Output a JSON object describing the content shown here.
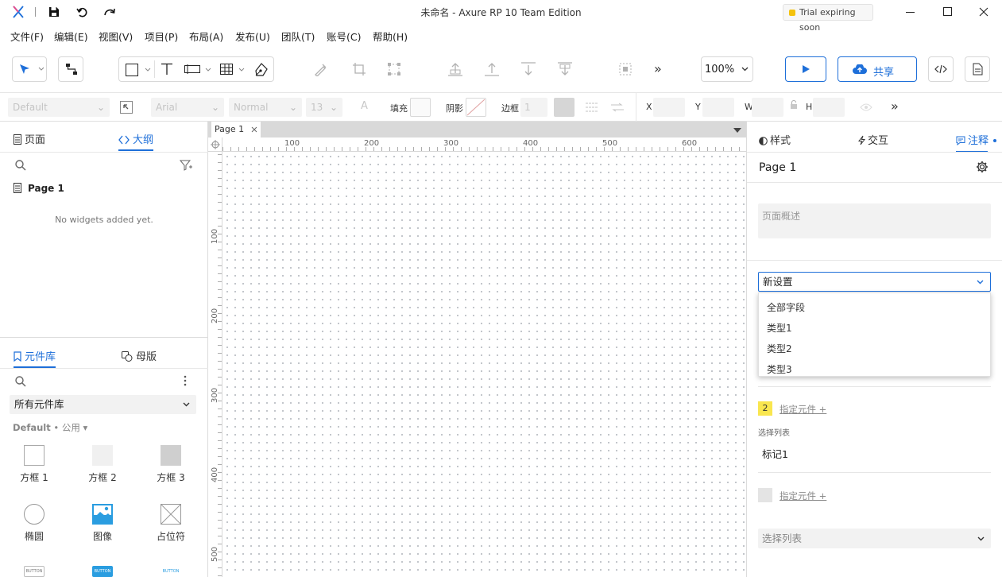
{
  "app": {
    "title": "未命名 - Axure RP 10 Team Edition",
    "trial_badge": "Trial expiring soon"
  },
  "menu": [
    "文件(F)",
    "编辑(E)",
    "视图(V)",
    "项目(P)",
    "布局(A)",
    "发布(U)",
    "团队(T)",
    "账号(C)",
    "帮助(H)"
  ],
  "toolbar": {
    "zoom": "100%",
    "share_label": "共享",
    "more": "»"
  },
  "format": {
    "style_select": "Default",
    "font_select": "Arial",
    "weight_select": "Normal",
    "size_select": "13",
    "fill_label": "填充",
    "shadow_label": "阴影",
    "border_label": "边框",
    "border_value": "1",
    "x_label": "X",
    "y_label": "Y",
    "w_label": "W",
    "h_label": "H"
  },
  "left": {
    "tab_pages": "页面",
    "tab_outline": "大纲",
    "page_item": "Page 1",
    "empty_text": "No widgets added yet.",
    "tab_library": "元件库",
    "tab_masters": "母版",
    "library_select": "所有元件库",
    "library_group": "Default",
    "library_sub": "公用",
    "widgets": [
      {
        "label": "方框 1"
      },
      {
        "label": "方框 2"
      },
      {
        "label": "方框 3"
      },
      {
        "label": "椭圆"
      },
      {
        "label": "图像"
      },
      {
        "label": "占位符"
      }
    ],
    "button_thumb": "BUTTON"
  },
  "canvas": {
    "tab_label": "Page 1",
    "h_ticks": [
      "100",
      "200",
      "300",
      "400",
      "500",
      "600"
    ],
    "v_ticks": [
      "100",
      "200",
      "300",
      "400",
      "500"
    ]
  },
  "right": {
    "tab_style": "样式",
    "tab_interact": "交互",
    "tab_notes": "注释",
    "page_title": "Page 1",
    "page_desc_placeholder": "页面概述",
    "dropdown_value": "新设置",
    "dropdown_options": [
      "全部字段",
      "类型1",
      "类型2",
      "类型3"
    ],
    "badge_number": "2",
    "assign_link": "指定元件 +",
    "select_list_label": "选择列表",
    "marker_value": "标记1",
    "assign_link2": "指定元件 +",
    "select_list_placeholder": "选择列表"
  },
  "colors": {
    "accent": "#1e6fd9",
    "badge_yellow": "#f9e64f",
    "trial_dot": "#f4c20d"
  }
}
